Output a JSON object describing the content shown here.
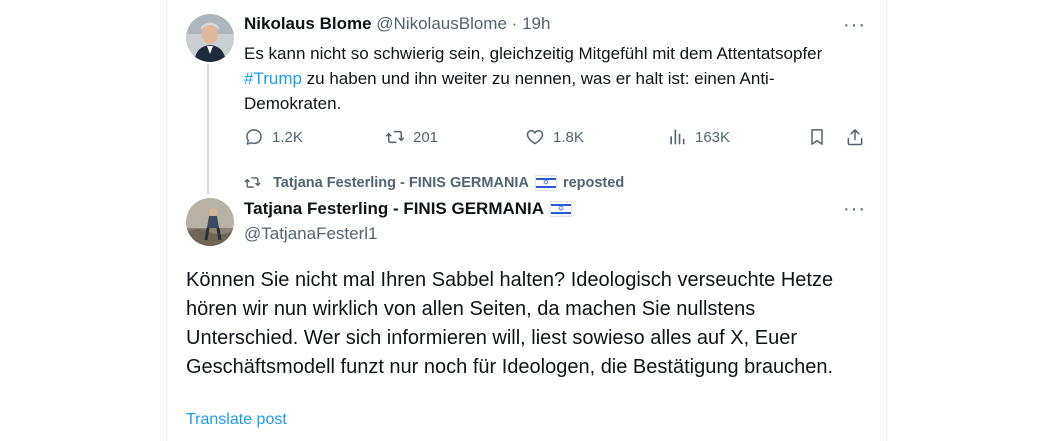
{
  "tweet1": {
    "author_name": "Nikolaus Blome",
    "handle": "@NikolausBlome",
    "separator": "·",
    "time": "19h",
    "text_before": "Es kann nicht so schwierig sein, gleichzeitig Mitgefühl mit dem Attentatsopfer ",
    "hashtag": "#Trump",
    "text_after": " zu haben und ihn weiter zu nennen, was er halt ist: einen Anti-Demokraten.",
    "metrics": {
      "replies": "1.2K",
      "reposts": "201",
      "likes": "1.8K",
      "views": "163K"
    }
  },
  "repost_notice": {
    "name": "Tatjana Festerling - FINIS GERMANIA",
    "label": "reposted"
  },
  "tweet2": {
    "author_name": "Tatjana Festerling - FINIS GERMANIA",
    "handle": "@TatjanaFesterl1",
    "text": "Können Sie nicht mal Ihren Sabbel halten? Ideologisch verseuchte Hetze hören wir nun wirklich von allen Seiten, da machen Sie nullstens Unterschied. Wer sich informieren will, liest sowieso alles auf X, Euer Geschäftsmodell funzt nur noch für Ideologen, die Bestätigung brauchen.",
    "translate_label": "Translate post"
  },
  "colors": {
    "accent": "#1d9bf0",
    "muted": "#536471",
    "text": "#0f1419"
  },
  "icons": [
    "more-icon",
    "reply-icon",
    "repost-icon",
    "like-icon",
    "views-icon",
    "bookmark-icon",
    "share-icon",
    "israel-flag-icon"
  ]
}
